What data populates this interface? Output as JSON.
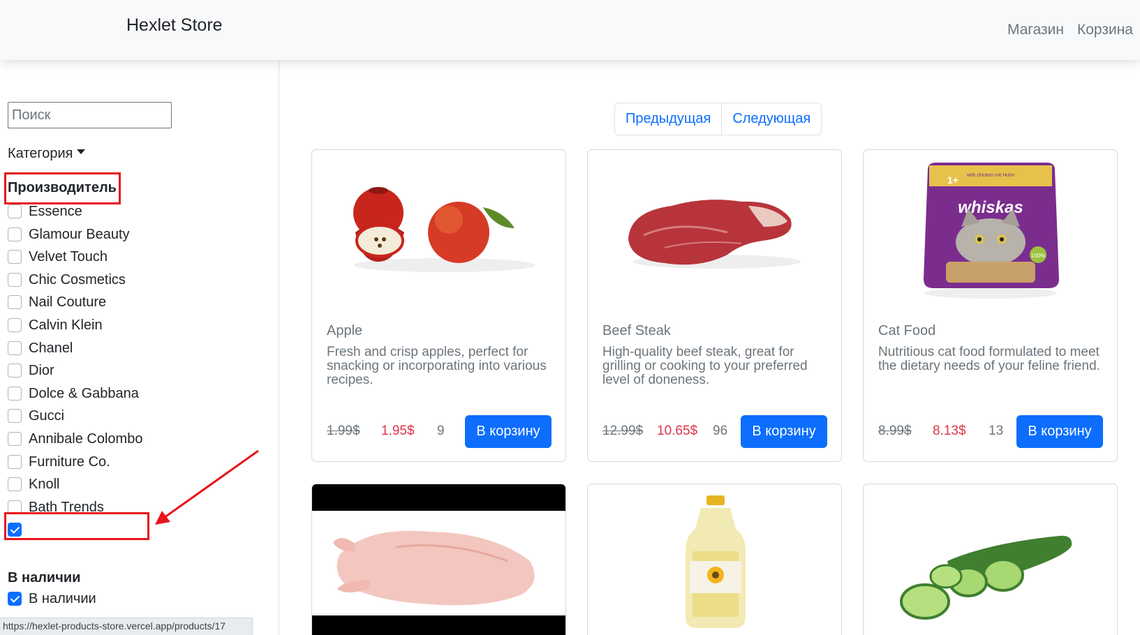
{
  "navbar": {
    "brand": "Hexlet Store",
    "links": [
      "Магазин",
      "Корзина"
    ]
  },
  "sidebar": {
    "search_placeholder": "Поиск",
    "category_label": "Категория",
    "manufacturer_title": "Производитель",
    "manufacturers": [
      {
        "label": "Essence",
        "checked": false
      },
      {
        "label": "Glamour Beauty",
        "checked": false
      },
      {
        "label": "Velvet Touch",
        "checked": false
      },
      {
        "label": "Chic Cosmetics",
        "checked": false
      },
      {
        "label": "Nail Couture",
        "checked": false
      },
      {
        "label": "Calvin Klein",
        "checked": false
      },
      {
        "label": "Chanel",
        "checked": false
      },
      {
        "label": "Dior",
        "checked": false
      },
      {
        "label": "Dolce & Gabbana",
        "checked": false
      },
      {
        "label": "Gucci",
        "checked": false
      },
      {
        "label": "Annibale Colombo",
        "checked": false
      },
      {
        "label": "Furniture Co.",
        "checked": false
      },
      {
        "label": "Knoll",
        "checked": false
      },
      {
        "label": "Bath Trends",
        "checked": false
      },
      {
        "label": "",
        "checked": true
      }
    ],
    "availability_title": "В наличии",
    "availability_option": {
      "label": "В наличии",
      "checked": true
    }
  },
  "statusbar": {
    "url": "https://hexlet-products-store.vercel.app/products/17"
  },
  "pagination": {
    "prev": "Предыдущая",
    "next": "Следующая"
  },
  "products": [
    {
      "title": "Apple",
      "description": "Fresh and crisp apples, perfect for snacking or incorporating into various recipes.",
      "old_price": "1.99$",
      "new_price": "1.95$",
      "stock": "9",
      "button": "В корзину",
      "image": "apple-image"
    },
    {
      "title": "Beef Steak",
      "description": "High-quality beef steak, great for grilling or cooking to your preferred level of doneness.",
      "old_price": "12.99$",
      "new_price": "10.65$",
      "stock": "96",
      "button": "В корзину",
      "image": "beef-steak-image"
    },
    {
      "title": "Cat Food",
      "description": "Nutritious cat food formulated to meet the dietary needs of your feline friend.",
      "old_price": "8.99$",
      "new_price": "8.13$",
      "stock": "13",
      "button": "В корзину",
      "image": "cat-food-image",
      "image_text": {
        "brand": "whiskas",
        "age": "1+",
        "flavor": "with chicken mit Huhn",
        "badge": "100%"
      }
    },
    {
      "image": "chicken-image"
    },
    {
      "image": "cooking-oil-image"
    },
    {
      "image": "cucumber-image"
    }
  ],
  "colors": {
    "accent": "#0d6efd",
    "sale_price": "#dc3545",
    "muted": "#6c757d",
    "annotation": "#e8131b"
  }
}
